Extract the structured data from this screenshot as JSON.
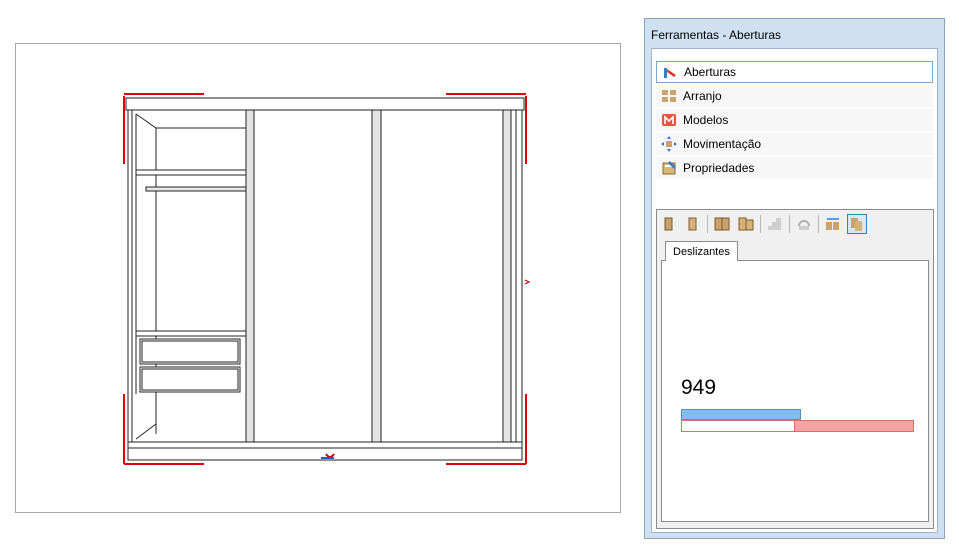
{
  "window": {
    "title": "Ferramentas - Aberturas"
  },
  "menu": {
    "items": [
      {
        "label": "Aberturas",
        "icon": "aberturas-icon",
        "active": true
      },
      {
        "label": "Arranjo",
        "icon": "arranjo-icon",
        "active": false
      },
      {
        "label": "Modelos",
        "icon": "modelos-icon",
        "active": false
      },
      {
        "label": "Movimentação",
        "icon": "movimentacao-icon",
        "active": false
      },
      {
        "label": "Propriedades",
        "icon": "propriedades-icon",
        "active": false
      }
    ]
  },
  "toolbar": {
    "buttons": [
      "door-single-icon",
      "door-single-alt-icon",
      "door-double-icon",
      "door-double-alt-icon",
      "stairs-icon",
      "rotate-icon",
      "sliding-icon",
      "sliding-selected-icon"
    ]
  },
  "tab": {
    "label": "Deslizantes"
  },
  "preview": {
    "measure": "949"
  },
  "colors": {
    "accent": "#7fbcf0",
    "red": "#f5a3a3",
    "frame_red": "#e00000"
  }
}
